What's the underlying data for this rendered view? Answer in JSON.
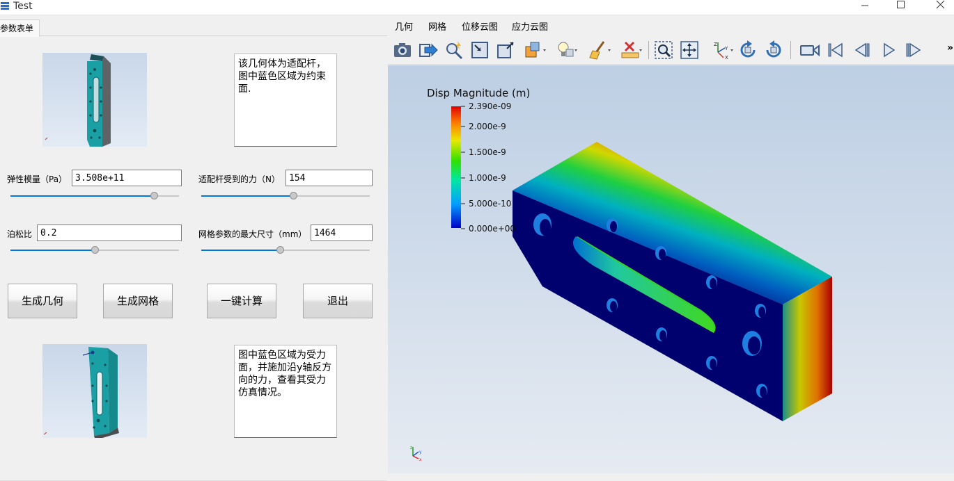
{
  "window": {
    "title": "Test"
  },
  "left_tabs": [
    {
      "label": "参数表单"
    }
  ],
  "top_image_text": "该几何体为适配杆，图中蓝色区域为约束面.",
  "bottom_image_text": "图中蓝色区域为受力面，并施加沿y轴反方向的力，查看其受力仿真情况。",
  "fields": {
    "elastic_modulus": {
      "label": "弹性模量（Pa）",
      "value": "3.508e+11",
      "slider_fraction": 0.84
    },
    "force": {
      "label": "适配杆受到的力（N）",
      "value": "154",
      "slider_fraction": 0.55
    },
    "poisson": {
      "label": "泊松比",
      "value": "0.2",
      "slider_fraction": 0.5
    },
    "mesh_size": {
      "label": "网格参数的最大尺寸（mm）",
      "value": "1464",
      "slider_fraction": 0.47
    }
  },
  "buttons": {
    "gen_geometry": "生成几何",
    "gen_mesh": "生成网格",
    "compute": "一键计算",
    "exit": "退出"
  },
  "right_menu": [
    {
      "label": "几何"
    },
    {
      "label": "网格"
    },
    {
      "label": "位移云图"
    },
    {
      "label": "应力云图"
    }
  ],
  "toolbar_icons": [
    "camera-icon",
    "export-icon",
    "pick-icon",
    "zoom-box-icon",
    "zoom-fit-icon",
    "scale-icon",
    "light-icon",
    "render-style-icon",
    "clear-icon",
    "ruler-icon",
    "zoom-select-icon",
    "pan-icon",
    "axes-icon",
    "rotate-cw-icon",
    "rotate-ccw-icon",
    "video-icon",
    "first-frame-icon",
    "prev-frame-icon",
    "play-icon",
    "last-frame-icon",
    "more-icon"
  ],
  "toolbar_more": "»",
  "legend": {
    "title": "Disp Magnitude (m)",
    "ticks": [
      "2.390e-09",
      "2.000e-9",
      "1.500e-9",
      "1.000e-9",
      "5.000e-10",
      "0.000e+00"
    ]
  },
  "orientation_axes": {
    "x": "x",
    "y": "y",
    "z": "z"
  },
  "colors": {
    "accent": "#0078d7",
    "model_blue": "#00006e",
    "model_teal": "#1aa3a3"
  }
}
